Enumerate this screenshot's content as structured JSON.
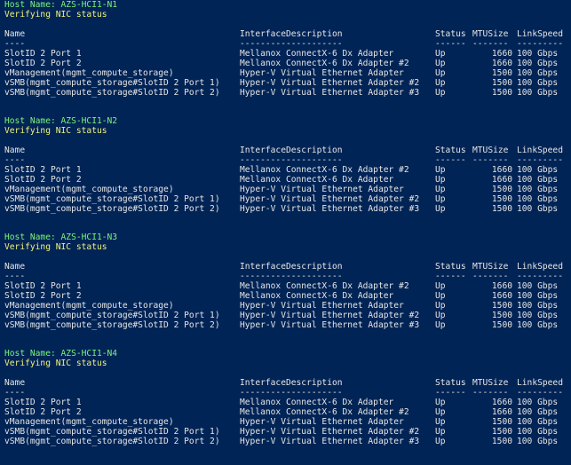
{
  "columns": {
    "name": "Name",
    "description": "InterfaceDescription",
    "status": "Status",
    "mtu": "MTUSize",
    "speed": "LinkSpeed"
  },
  "dividers": {
    "name": "----",
    "description": "--------------------",
    "status": "------",
    "mtu": "-------",
    "speed": "---------"
  },
  "blocks": [
    {
      "host": "Host Name: AZS-HCI1-N1",
      "message": "Verifying NIC status",
      "rows": [
        {
          "name": "SlotID 2 Port 1",
          "desc": "Mellanox ConnectX-6 Dx Adapter",
          "status": "Up",
          "mtu": "1660",
          "speed": "100 Gbps"
        },
        {
          "name": "SlotID 2 Port 2",
          "desc": "Mellanox ConnectX-6 Dx Adapter #2",
          "status": "Up",
          "mtu": "1660",
          "speed": "100 Gbps"
        },
        {
          "name": "vManagement(mgmt_compute_storage)",
          "desc": "Hyper-V Virtual Ethernet Adapter",
          "status": "Up",
          "mtu": "1500",
          "speed": "100 Gbps"
        },
        {
          "name": "vSMB(mgmt_compute_storage#SlotID 2 Port 1)",
          "desc": "Hyper-V Virtual Ethernet Adapter #2",
          "status": "Up",
          "mtu": "1500",
          "speed": "100 Gbps"
        },
        {
          "name": "vSMB(mgmt_compute_storage#SlotID 2 Port 2)",
          "desc": "Hyper-V Virtual Ethernet Adapter #3",
          "status": "Up",
          "mtu": "1500",
          "speed": "100 Gbps"
        }
      ]
    },
    {
      "host": "Host Name: AZS-HCI1-N2",
      "message": "Verifying NIC status",
      "rows": [
        {
          "name": "SlotID 2 Port 1",
          "desc": "Mellanox ConnectX-6 Dx Adapter #2",
          "status": "Up",
          "mtu": "1660",
          "speed": "100 Gbps"
        },
        {
          "name": "SlotID 2 Port 2",
          "desc": "Mellanox ConnectX-6 Dx Adapter",
          "status": "Up",
          "mtu": "1660",
          "speed": "100 Gbps"
        },
        {
          "name": "vManagement(mgmt_compute_storage)",
          "desc": "Hyper-V Virtual Ethernet Adapter",
          "status": "Up",
          "mtu": "1500",
          "speed": "100 Gbps"
        },
        {
          "name": "vSMB(mgmt_compute_storage#SlotID 2 Port 1)",
          "desc": "Hyper-V Virtual Ethernet Adapter #2",
          "status": "Up",
          "mtu": "1500",
          "speed": "100 Gbps"
        },
        {
          "name": "vSMB(mgmt_compute_storage#SlotID 2 Port 2)",
          "desc": "Hyper-V Virtual Ethernet Adapter #3",
          "status": "Up",
          "mtu": "1500",
          "speed": "100 Gbps"
        }
      ]
    },
    {
      "host": "Host Name: AZS-HCI1-N3",
      "message": "Verifying NIC status",
      "rows": [
        {
          "name": "SlotID 2 Port 1",
          "desc": "Mellanox ConnectX-6 Dx Adapter #2",
          "status": "Up",
          "mtu": "1660",
          "speed": "100 Gbps"
        },
        {
          "name": "SlotID 2 Port 2",
          "desc": "Mellanox ConnectX-6 Dx Adapter",
          "status": "Up",
          "mtu": "1660",
          "speed": "100 Gbps"
        },
        {
          "name": "vManagement(mgmt_compute_storage)",
          "desc": "Hyper-V Virtual Ethernet Adapter",
          "status": "Up",
          "mtu": "1500",
          "speed": "100 Gbps"
        },
        {
          "name": "vSMB(mgmt_compute_storage#SlotID 2 Port 1)",
          "desc": "Hyper-V Virtual Ethernet Adapter #2",
          "status": "Up",
          "mtu": "1500",
          "speed": "100 Gbps"
        },
        {
          "name": "vSMB(mgmt_compute_storage#SlotID 2 Port 2)",
          "desc": "Hyper-V Virtual Ethernet Adapter #3",
          "status": "Up",
          "mtu": "1500",
          "speed": "100 Gbps"
        }
      ]
    },
    {
      "host": "Host Name: AZS-HCI1-N4",
      "message": "Verifying NIC status",
      "rows": [
        {
          "name": "SlotID 2 Port 1",
          "desc": "Mellanox ConnectX-6 Dx Adapter",
          "status": "Up",
          "mtu": "1660",
          "speed": "100 Gbps"
        },
        {
          "name": "SlotID 2 Port 2",
          "desc": "Mellanox ConnectX-6 Dx Adapter #2",
          "status": "Up",
          "mtu": "1660",
          "speed": "100 Gbps"
        },
        {
          "name": "vManagement(mgmt_compute_storage)",
          "desc": "Hyper-V Virtual Ethernet Adapter",
          "status": "Up",
          "mtu": "1500",
          "speed": "100 Gbps"
        },
        {
          "name": "vSMB(mgmt_compute_storage#SlotID 2 Port 1)",
          "desc": "Hyper-V Virtual Ethernet Adapter #2",
          "status": "Up",
          "mtu": "1500",
          "speed": "100 Gbps"
        },
        {
          "name": "vSMB(mgmt_compute_storage#SlotID 2 Port 2)",
          "desc": "Hyper-V Virtual Ethernet Adapter #3",
          "status": "Up",
          "mtu": "1500",
          "speed": "100 Gbps"
        }
      ]
    }
  ]
}
